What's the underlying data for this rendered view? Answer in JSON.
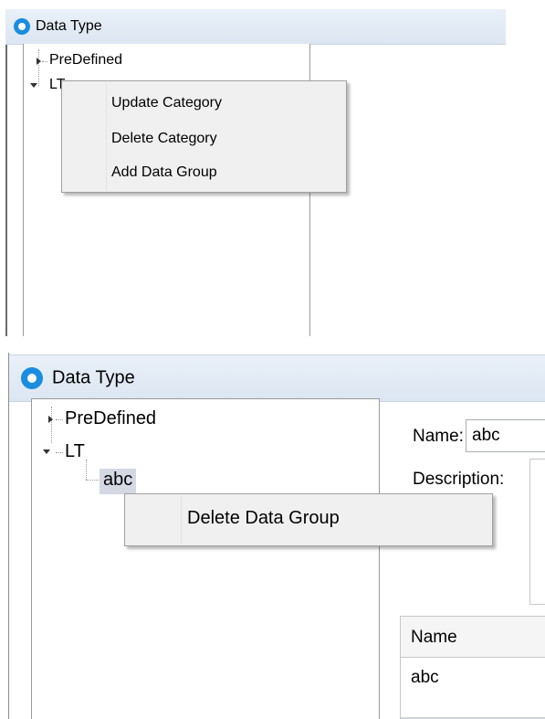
{
  "panel1": {
    "window_title": "Data Type",
    "app_icon": "app-icon",
    "tree": [
      {
        "label": "PreDefined",
        "expanded": false
      },
      {
        "label": "LT",
        "expanded": true
      }
    ],
    "context_menu": {
      "items": [
        "Update Category",
        "Delete Category",
        "Add Data Group"
      ]
    }
  },
  "panel2": {
    "window_title": "Data Type",
    "app_icon": "app-icon",
    "tree": [
      {
        "label": "PreDefined",
        "expanded": false
      },
      {
        "label": "LT",
        "expanded": true
      },
      {
        "label": "abc",
        "selected": true
      }
    ],
    "context_menu": {
      "items": [
        "Delete Data Group"
      ]
    },
    "form": {
      "name_label": "Name:",
      "name_value": "abc",
      "description_label": "Description:",
      "description_value": ""
    },
    "grid": {
      "columns": [
        "Name"
      ],
      "rows": [
        [
          "abc"
        ]
      ]
    }
  },
  "colors": {
    "accent": "#1a8de0",
    "titlebar": "#dce6f2",
    "menu_bg": "#f0f0f0",
    "selection": "#d3d8e3"
  }
}
